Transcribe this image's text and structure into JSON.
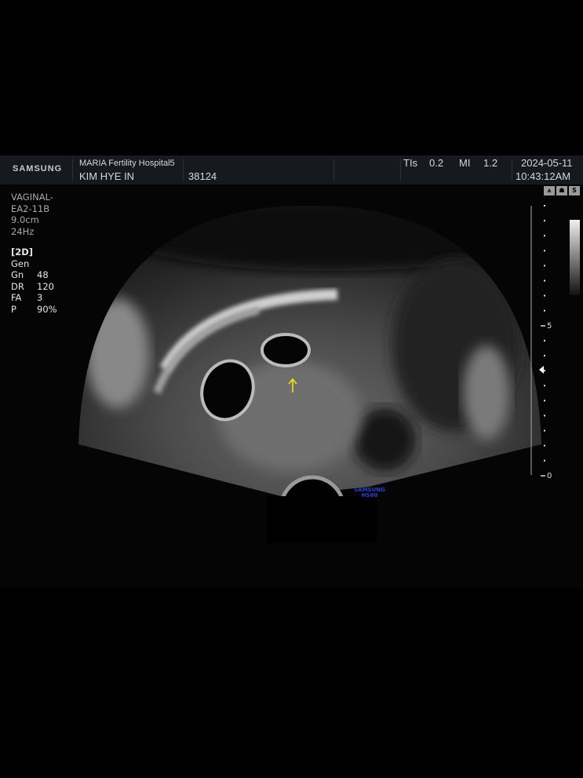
{
  "header": {
    "brand": "SAMSUNG",
    "hospital": "MARIA Fertility Hospital5",
    "patient_name": "KIM HYE IN",
    "patient_id": "38124",
    "tis_label": "TIs",
    "tis_value": "0.2",
    "mi_label": "MI",
    "mi_value": "1.2",
    "date": "2024-05-11",
    "time": "10:43:12AM"
  },
  "probe": {
    "line1": "VAGINAL-",
    "line2": "EA2-11B",
    "depth": "9.0cm",
    "frame_rate": "24Hz"
  },
  "params": {
    "mode": "[2D]",
    "preset": "Gen",
    "rows": [
      {
        "label": "Gn",
        "value": "48"
      },
      {
        "label": "DR",
        "value": "120"
      },
      {
        "label": "FA",
        "value": "3"
      },
      {
        "label": "P",
        "value": "90%"
      }
    ]
  },
  "status_icons": [
    "probe-icon",
    "baby-icon",
    "s-harmonic-icon"
  ],
  "status_icon_text": {
    "s": "S"
  },
  "depth_scale": {
    "labels": [
      "5",
      "0"
    ]
  },
  "watermark": {
    "line1": "SAMSUNG",
    "line2": "HS60"
  },
  "colors": {
    "header_bg": "#16191d",
    "arrow": "#f5e21a",
    "watermark": "#2a3fd0"
  }
}
